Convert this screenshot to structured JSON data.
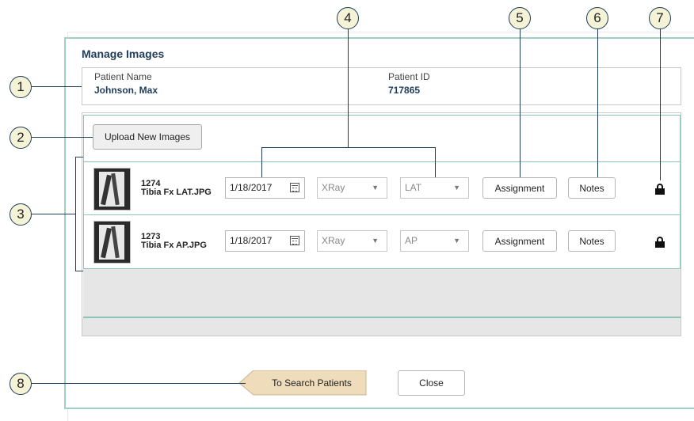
{
  "dialog": {
    "title": "Manage Images"
  },
  "patient": {
    "name_label": "Patient Name",
    "name_value": "Johnson, Max",
    "id_label": "Patient ID",
    "id_value": "717865"
  },
  "upload_button": "Upload New Images",
  "images": [
    {
      "id": "1274",
      "filename": "Tibia Fx LAT.JPG",
      "date": "1/18/2017",
      "type": "XRay",
      "view": "LAT",
      "assignment_label": "Assignment",
      "notes_label": "Notes",
      "locked": true
    },
    {
      "id": "1273",
      "filename": "Tibia Fx AP.JPG",
      "date": "1/18/2017",
      "type": "XRay",
      "view": "AP",
      "assignment_label": "Assignment",
      "notes_label": "Notes",
      "locked": true
    }
  ],
  "footer": {
    "back_label": "To Search Patients",
    "close_label": "Close"
  },
  "callouts": [
    "1",
    "2",
    "3",
    "4",
    "5",
    "6",
    "7",
    "8"
  ],
  "icons": {
    "lock": "lock-icon",
    "calendar": "calendar-icon",
    "dropdown": "chevron-down-icon"
  },
  "colors": {
    "accent": "#9fd0c3",
    "title": "#1f3c5a",
    "callout_fill": "#f4f3d6",
    "back_button": "#eedcbb"
  }
}
